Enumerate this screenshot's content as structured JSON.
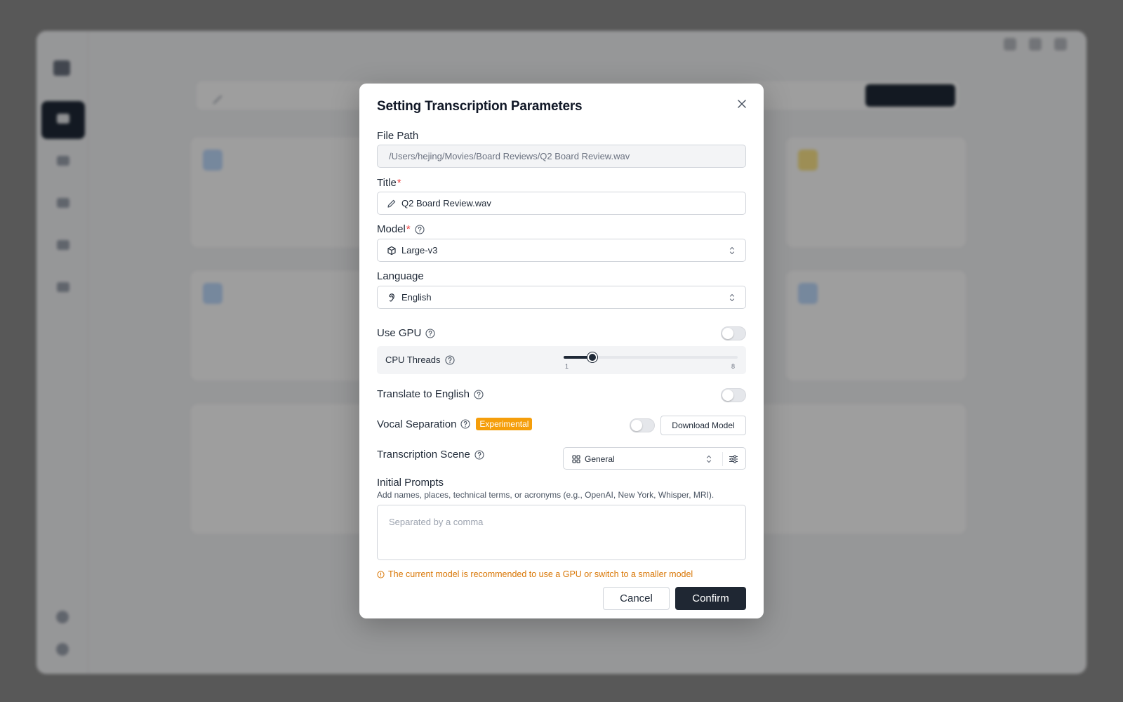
{
  "modal": {
    "title": "Setting Transcription Parameters",
    "file_path": {
      "label": "File Path",
      "value": "/Users/hejing/Movies/Board Reviews/Q2 Board Review.wav"
    },
    "title_field": {
      "label": "Title",
      "required_mark": "*",
      "value": "Q2 Board Review.wav"
    },
    "model": {
      "label": "Model",
      "required_mark": "*",
      "value": "Large-v3"
    },
    "language": {
      "label": "Language",
      "value": "English"
    },
    "use_gpu": {
      "label": "Use GPU",
      "enabled": false
    },
    "cpu_threads": {
      "label": "CPU Threads",
      "min": "1",
      "max": "8",
      "value": 2
    },
    "translate": {
      "label": "Translate to English",
      "enabled": false
    },
    "vocal_separation": {
      "label": "Vocal Separation",
      "badge": "Experimental",
      "enabled": false,
      "download_label": "Download Model"
    },
    "scene": {
      "label": "Transcription Scene",
      "value": "General"
    },
    "initial_prompts": {
      "label": "Initial Prompts",
      "hint": "Add names, places, technical terms, or acronyms (e.g., OpenAI, New York, Whisper, MRI).",
      "placeholder": "Separated by a comma"
    },
    "warning": "The current model is recommended to use a GPU or switch to a smaller model",
    "cancel_label": "Cancel",
    "confirm_label": "Confirm"
  },
  "colors": {
    "accent_dark": "#1f2733",
    "warning": "#d97706",
    "experimental_badge": "#f59e0b",
    "required": "#ef4444"
  }
}
